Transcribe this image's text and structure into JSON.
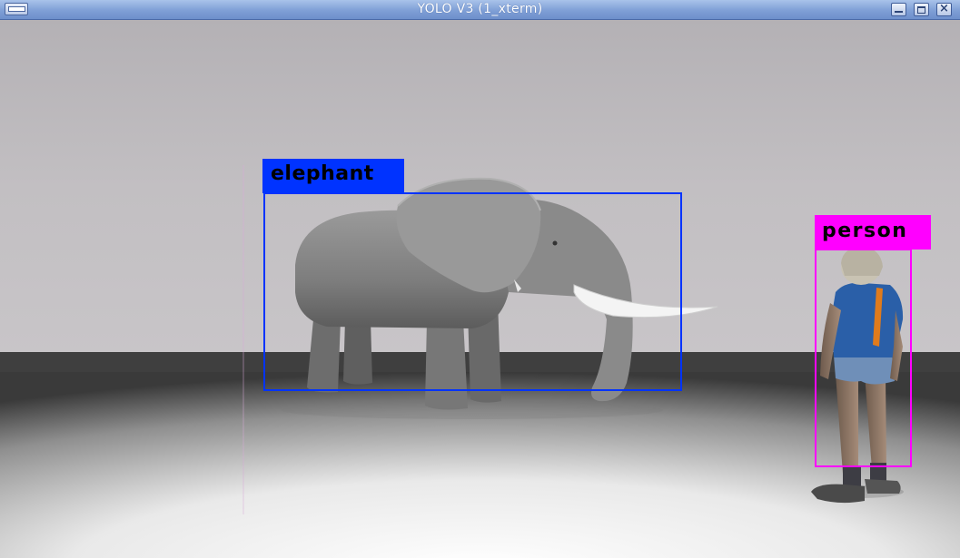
{
  "window": {
    "title": "YOLO V3 (1_xterm)"
  },
  "detections": [
    {
      "label": "elephant",
      "color": "#0033ff"
    },
    {
      "label": "person",
      "color": "#ff00ff"
    }
  ],
  "colors": {
    "wall": "#bdbabd",
    "floor": "#ffffff",
    "titlebar": "#7f9fd6"
  },
  "icons": {
    "window_menu": "window-menu-icon",
    "minimize": "minimize-icon",
    "maximize": "maximize-icon",
    "close": "close-icon"
  }
}
